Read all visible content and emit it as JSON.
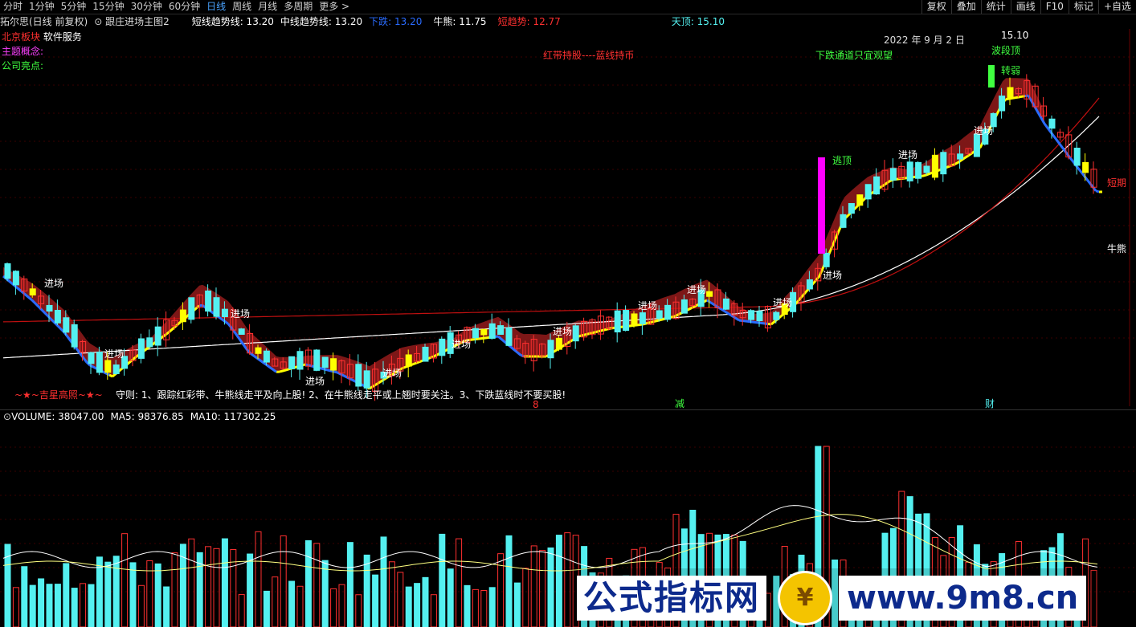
{
  "toolbar": {
    "periods": [
      "分时",
      "1分钟",
      "5分钟",
      "15分钟",
      "30分钟",
      "60分钟",
      "日线",
      "周线",
      "月线",
      "多周期",
      "更多 >"
    ],
    "active_period": "日线",
    "right_buttons": [
      "复权",
      "叠加",
      "统计",
      "画线",
      "F10",
      "标记",
      "+自选"
    ]
  },
  "header": {
    "stock_title": "拓尔思(日线 前复权)",
    "formula_name": "跟庄进场主图2",
    "short_trend": "短线趋势线: 13.20",
    "mid_trend": "中线趋势线: 13.20",
    "fall": "下跌: 13.20",
    "bull_bear": "牛熊: 11.75",
    "short_signal": "短趋势: 12.77",
    "sky_top": "天顶: 15.10"
  },
  "info_panel": {
    "block_label": "北京板块",
    "block_value": "软件服务",
    "theme_label": "主题概念:",
    "highlight_label": "公司亮点:"
  },
  "annotations": {
    "date": "2022 年 9 月 2 日",
    "hold_text": "红带持股----蓝线持币",
    "down_text": "下跌通道只宜观望",
    "wave_top": "波段顶",
    "escape_top": "逃顶",
    "turn_weak": "转弱",
    "top_price": "15.10",
    "enter": "进场",
    "short_term": "短期",
    "bull_bear_line": "牛熊",
    "lucky_star": "~★~吉星高照~★~",
    "rules": "守则: 1、跟踪红彩带、牛熊线走平及向上股! 2、在牛熊线走平或上翘时要关注。3、下跌蓝线时不要买股!",
    "marker_1": "8",
    "marker_2": "减",
    "marker_3": "财"
  },
  "volume": {
    "label": "VOLUME: 38047.00",
    "ma5": "MA5: 98376.85",
    "ma10": "MA10: 117302.25"
  },
  "watermark": {
    "cn": "公式指标网",
    "url": "www.9m8.cn"
  },
  "colors": {
    "up": "#ff3030",
    "down": "#54f0f0",
    "yellow": "#ffff00",
    "band": "#8b1a1a",
    "blue": "#2a6cff",
    "white_line": "#ffffff",
    "red_line": "#c01010",
    "magenta": "#ff00ff",
    "green": "#40ff40"
  }
}
